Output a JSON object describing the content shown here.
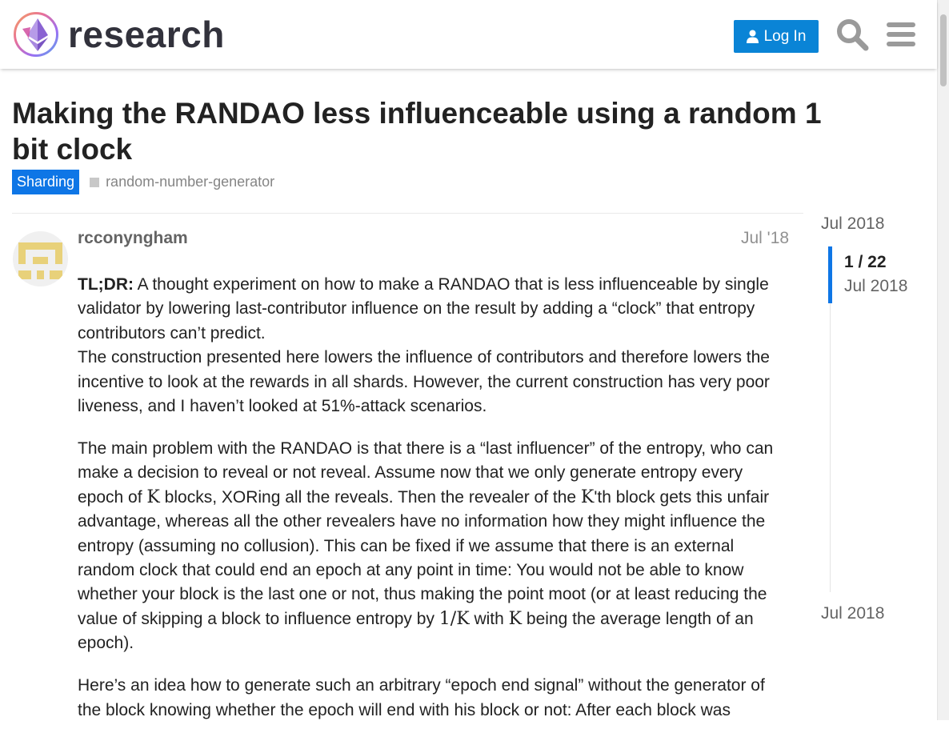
{
  "header": {
    "site_name": "research",
    "login_label": "Log In",
    "icons": [
      "logo-icon",
      "user-icon",
      "search-icon",
      "hamburger-menu-icon"
    ],
    "accent_color": "#0a84d6"
  },
  "topic": {
    "title": "Making the RANDAO less influenceable using a random 1 bit clock",
    "category": "Sharding",
    "category_color": "#0e76e6",
    "tag": "random-number-generator"
  },
  "post": {
    "username": "rcconyngham",
    "date": "Jul '18",
    "p1_lead": "TL;DR:",
    "p1_text": " A thought experiment on how to make a RANDAO that is less influenceable by single validator by lowering last-contributor influence on the result by adding a “clock” that entropy contributors can’t predict.",
    "p2": "The construction presented here lowers the influence of contributors and therefore lowers the incentive to look at the rewards in all shards. However, the current construction has very poor liveness, and I haven’t looked at 51%-attack scenarios.",
    "p3_a": "The main problem with the RANDAO is that there is a “last influencer” of the entropy, who can make a decision to reveal or not reveal. Assume now that we only generate entropy every epoch of ",
    "math_k": "K",
    "p3_b": " blocks, XORing all the reveals. Then the revealer of the ",
    "p3_c": "'th block gets this unfair advantage, whereas all the other revealers have no information how they might influence the entropy (assuming no collusion). This can be fixed if we assume that there is an external random clock that could end an epoch at any point in time: You would not be able to know whether your block is the last one or not, thus making the point moot (or at least reducing the value of skipping a block to influence entropy by ",
    "math_inv_k": "1/K",
    "p3_d": " with ",
    "p3_e": " being the average length of an epoch).",
    "p4": "Here’s an idea how to generate such an arbitrary “epoch end signal” without the generator of the block knowing whether the epoch will end with his block or not: After each block was"
  },
  "timeline": {
    "start_date": "Jul 2018",
    "position": "1 / 22",
    "position_date": "Jul 2018",
    "end_date": "Jul 2018"
  }
}
